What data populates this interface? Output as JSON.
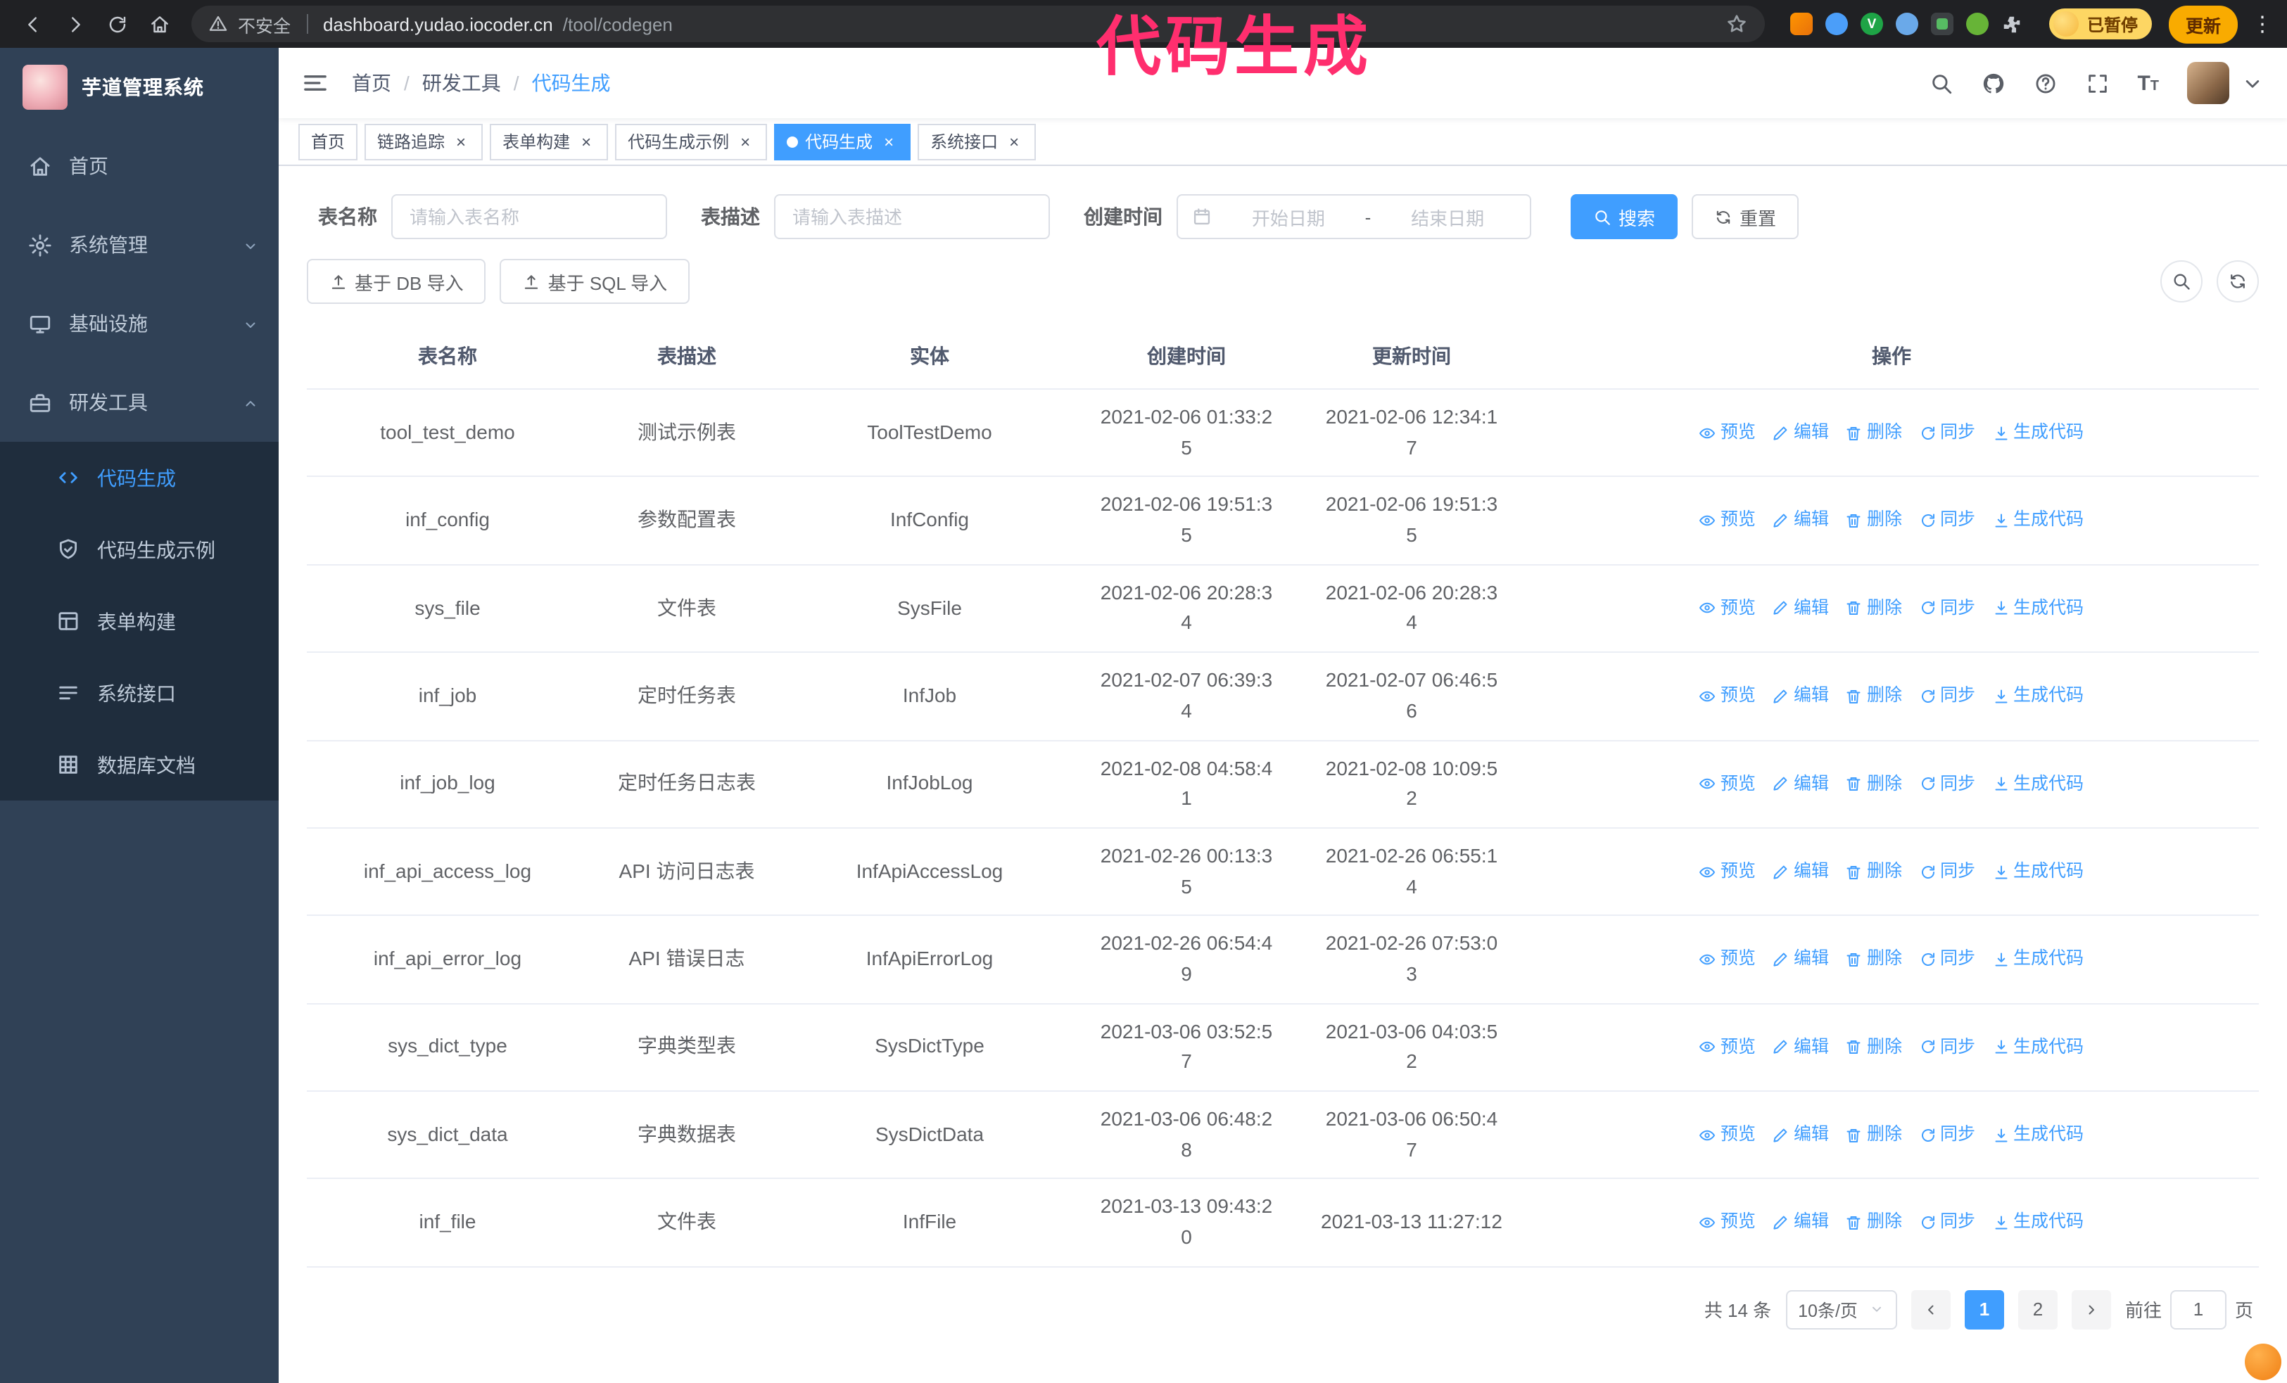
{
  "colors": {
    "accent": "#409eff",
    "sidebar_bg": "#304156",
    "submenu_bg": "#1f2d3d",
    "sidebar_text": "#bfcbd9",
    "annotation": "#ff2e6e",
    "chrome_bg": "#202124",
    "tag_border": "#d8dce5",
    "table_border": "#ebeef5"
  },
  "browser": {
    "security_label": "不安全",
    "url_host": "dashboard.yudao.iocoder.cn",
    "url_path": "/tool/codegen",
    "profile_status": "已暂停",
    "update_label": "更新",
    "nav_icons": [
      "back-icon",
      "forward-icon",
      "reload-icon",
      "home-icon"
    ],
    "extension_icons": [
      "orange-extension-icon",
      "blue-extension-icon",
      "green-v-extension-icon",
      "people-extension-icon",
      "dark-extension-icon",
      "leaf-extension-icon",
      "puzzle-extensions-icon"
    ]
  },
  "annotation": {
    "text": "代码生成"
  },
  "sidebar": {
    "logo_title": "芋道管理系统",
    "items": [
      {
        "label": "首页",
        "icon": "home-icon"
      },
      {
        "label": "系统管理",
        "icon": "gear-icon",
        "expandable": true,
        "expanded": false
      },
      {
        "label": "基础设施",
        "icon": "monitor-icon",
        "expandable": true,
        "expanded": false
      },
      {
        "label": "研发工具",
        "icon": "toolbox-icon",
        "expandable": true,
        "expanded": true,
        "children": [
          {
            "label": "代码生成",
            "icon": "code-icon",
            "active": true
          },
          {
            "label": "代码生成示例",
            "icon": "shield-check-icon",
            "active": false
          },
          {
            "label": "表单构建",
            "icon": "form-icon",
            "active": false
          },
          {
            "label": "系统接口",
            "icon": "api-icon",
            "active": false
          },
          {
            "label": "数据库文档",
            "icon": "database-icon",
            "active": false
          }
        ]
      }
    ]
  },
  "header": {
    "breadcrumb": [
      "首页",
      "研发工具",
      "代码生成"
    ],
    "breadcrumb_separator": "/",
    "right_icons": [
      "search-icon",
      "github-icon",
      "question-icon",
      "fullscreen-icon",
      "font-size-icon"
    ]
  },
  "tabs": [
    {
      "label": "首页",
      "closable": false,
      "active": false
    },
    {
      "label": "链路追踪",
      "closable": true,
      "active": false
    },
    {
      "label": "表单构建",
      "closable": true,
      "active": false
    },
    {
      "label": "代码生成示例",
      "closable": true,
      "active": false
    },
    {
      "label": "代码生成",
      "closable": true,
      "active": true
    },
    {
      "label": "系统接口",
      "closable": true,
      "active": false
    }
  ],
  "filters": {
    "table_name_label": "表名称",
    "table_name_placeholder": "请输入表名称",
    "table_desc_label": "表描述",
    "table_desc_placeholder": "请输入表描述",
    "create_time_label": "创建时间",
    "date_start_placeholder": "开始日期",
    "date_separator": "-",
    "date_end_placeholder": "结束日期",
    "search_button": "搜索",
    "reset_button": "重置"
  },
  "toolbar": {
    "import_db_button": "基于 DB 导入",
    "import_sql_button": "基于 SQL 导入"
  },
  "table": {
    "columns": [
      "表名称",
      "表描述",
      "实体",
      "创建时间",
      "更新时间",
      "操作"
    ],
    "actions": [
      "预览",
      "编辑",
      "删除",
      "同步",
      "生成代码"
    ],
    "rows": [
      {
        "name": "tool_test_demo",
        "desc": "测试示例表",
        "entity": "ToolTestDemo",
        "created": "2021-02-06 01:33:25",
        "updated": "2021-02-06 12:34:17"
      },
      {
        "name": "inf_config",
        "desc": "参数配置表",
        "entity": "InfConfig",
        "created": "2021-02-06 19:51:35",
        "updated": "2021-02-06 19:51:35"
      },
      {
        "name": "sys_file",
        "desc": "文件表",
        "entity": "SysFile",
        "created": "2021-02-06 20:28:34",
        "updated": "2021-02-06 20:28:34"
      },
      {
        "name": "inf_job",
        "desc": "定时任务表",
        "entity": "InfJob",
        "created": "2021-02-07 06:39:34",
        "updated": "2021-02-07 06:46:56"
      },
      {
        "name": "inf_job_log",
        "desc": "定时任务日志表",
        "entity": "InfJobLog",
        "created": "2021-02-08 04:58:41",
        "updated": "2021-02-08 10:09:52"
      },
      {
        "name": "inf_api_access_log",
        "desc": "API 访问日志表",
        "entity": "InfApiAccessLog",
        "created": "2021-02-26 00:13:35",
        "updated": "2021-02-26 06:55:14"
      },
      {
        "name": "inf_api_error_log",
        "desc": "API 错误日志",
        "entity": "InfApiErrorLog",
        "created": "2021-02-26 06:54:49",
        "updated": "2021-02-26 07:53:03"
      },
      {
        "name": "sys_dict_type",
        "desc": "字典类型表",
        "entity": "SysDictType",
        "created": "2021-03-06 03:52:57",
        "updated": "2021-03-06 04:03:52"
      },
      {
        "name": "sys_dict_data",
        "desc": "字典数据表",
        "entity": "SysDictData",
        "created": "2021-03-06 06:48:28",
        "updated": "2021-03-06 06:50:47"
      },
      {
        "name": "inf_file",
        "desc": "文件表",
        "entity": "InfFile",
        "created": "2021-03-13 09:43:20",
        "updated": "2021-03-13 11:27:12"
      }
    ]
  },
  "pagination": {
    "total_text": "共 14 条",
    "page_size": "10条/页",
    "pages": [
      "1",
      "2"
    ],
    "active_page": "1",
    "goto_label": "前往",
    "goto_value": "1",
    "goto_suffix": "页"
  }
}
